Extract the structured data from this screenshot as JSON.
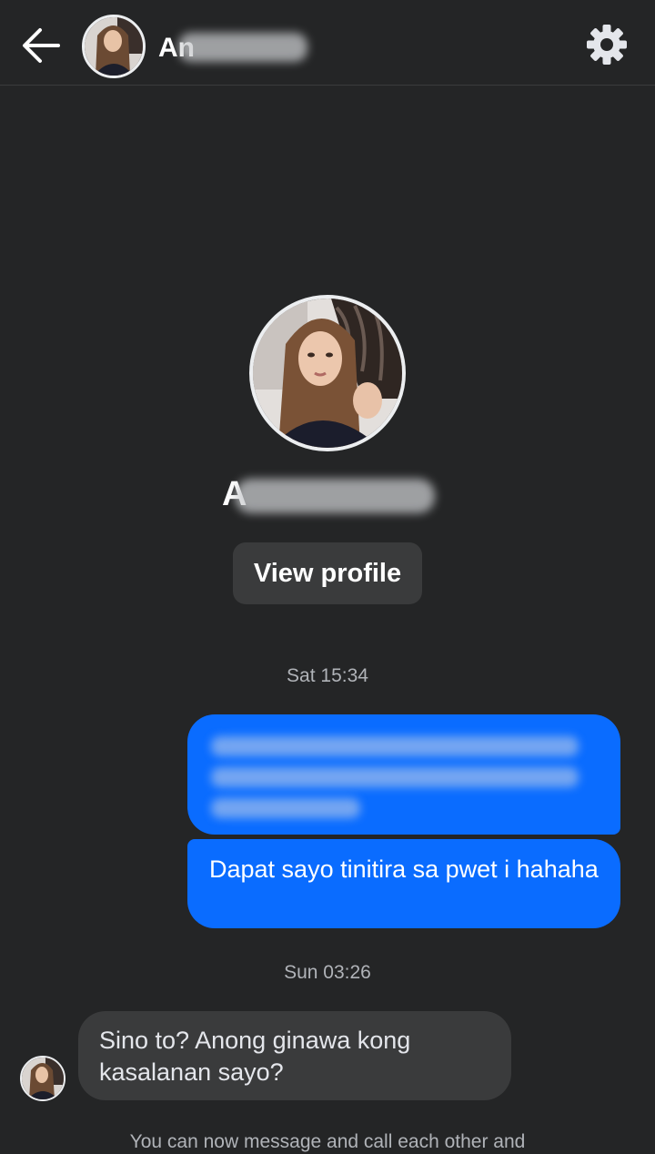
{
  "header": {
    "back_icon": "arrow-left-icon",
    "contact_name": "An",
    "settings_icon": "gear-icon"
  },
  "profile": {
    "name": "A",
    "view_profile_label": "View profile"
  },
  "messages": {
    "timestamp_1": "Sat 15:34",
    "outgoing_2": "Dapat sayo tinitira sa pwet i hahaha",
    "timestamp_2": "Sun 03:26",
    "incoming_1": "Sino to? Anong ginawa kong kasalanan sayo?"
  },
  "footer": {
    "note": "You can now message and call each other and"
  },
  "colors": {
    "background": "#242526",
    "outgoing_bubble": "#0a6cff",
    "incoming_bubble": "#3a3b3c",
    "button_bg": "#3a3b3c"
  }
}
